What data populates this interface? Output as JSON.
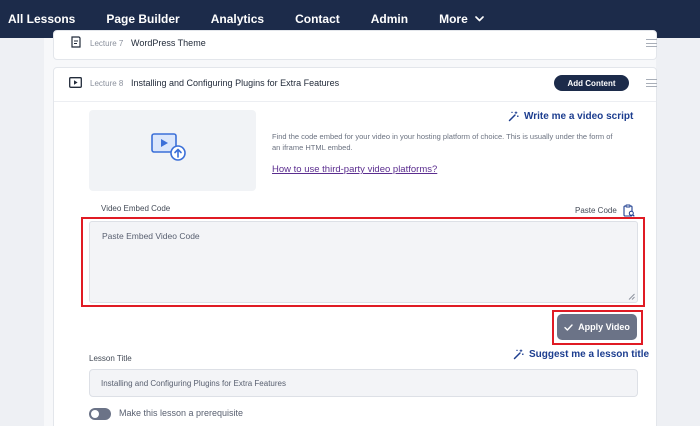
{
  "nav": {
    "items": [
      "All Lessons",
      "Page Builder",
      "Analytics",
      "Contact",
      "Admin"
    ],
    "more_label": "More"
  },
  "prev_lecture": {
    "number": "Lecture 7",
    "title": "WordPress Theme"
  },
  "lecture": {
    "number": "Lecture 8",
    "title": "Installing and Configuring Plugins for Extra Features",
    "add_content_label": "Add Content"
  },
  "video": {
    "ai_script_label": "Write me a video script",
    "help_text": "Find the code embed for your video in your hosting platform of choice. This is usually under the form of an iframe HTML embed.",
    "help_link": "How to use third-party video platforms?",
    "embed_label": "Video Embed Code",
    "paste_label": "Paste Code",
    "embed_placeholder": "Paste Embed Video Code",
    "apply_label": "Apply Video"
  },
  "lesson": {
    "title_label": "Lesson Title",
    "ai_title_label": "Suggest me a lesson title",
    "title_value": "Installing and Configuring Plugins for Extra Features",
    "prerequisite_label": "Make this lesson a prerequisite"
  },
  "colors": {
    "nav_bg": "#1c2b4a",
    "accent_link": "#1c3d8f",
    "highlight": "#e01b24",
    "apply_button": "#6b7387"
  },
  "icons": {
    "more": "chevron-down-icon",
    "prev_lecture": "document-icon",
    "lecture": "video-play-icon",
    "drag": "drag-handle-icon",
    "thumbnail": "video-upload-icon",
    "ai": "magic-wand-icon",
    "paste": "clipboard-icon",
    "apply": "checkmark-icon",
    "resize": "resize-grip-icon"
  }
}
